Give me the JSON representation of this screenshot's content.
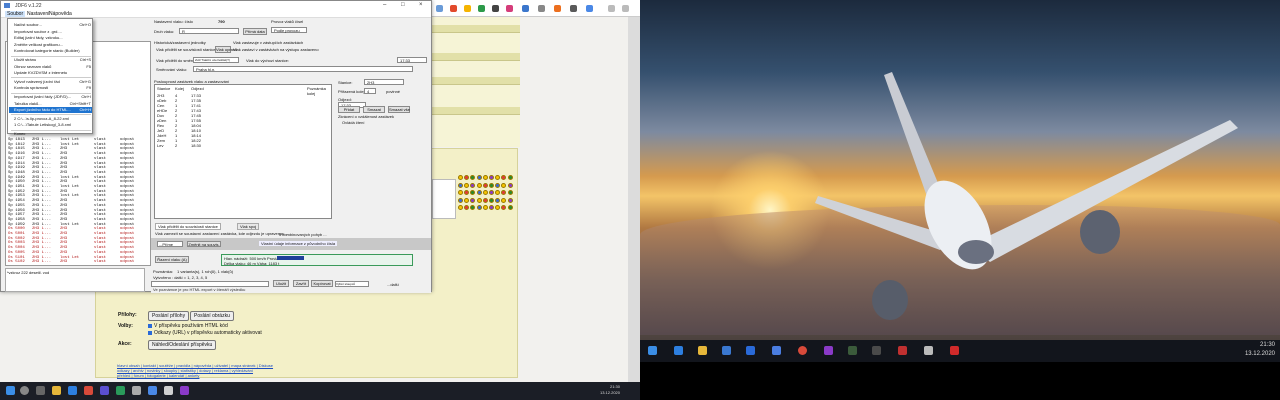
{
  "app": {
    "title": "JDF6 v.1.22",
    "menu": [
      "Soubor",
      "Nastavení",
      "Nápověda"
    ],
    "menu_colors": {
      "accent": "#1f74d0"
    }
  },
  "dropdown": {
    "items": [
      {
        "label": "Načíst soubor...",
        "key": "Ctrl+O"
      },
      {
        "label": "Importovat soubor z .grd....",
        "key": ""
      },
      {
        "label": "Editaj jízdní řády, vzkroku...",
        "key": ""
      },
      {
        "label": "Změňte velikost grafikonu...",
        "key": ""
      },
      {
        "label": "Kontrolovat kategorie stanic (Builder)",
        "key": ""
      },
      {
        "label": "Uložit stránu",
        "key": "Ctrl+S"
      },
      {
        "label": "Obnov seznam vlaků",
        "key": "F5"
      },
      {
        "label": "Update KVZDVSM z internetu",
        "key": ""
      },
      {
        "label": "Vytvoř nalezený jízdní řád",
        "key": "Ctrl+G"
      },
      {
        "label": "Kontrola správnosti",
        "key": "F9"
      },
      {
        "label": "Importovat jízdní řády (JDF/D)...",
        "key": "Ctrl+I"
      },
      {
        "label": "Tabulka vlaků...",
        "key": "Ctrl+Shift+T"
      },
      {
        "label": "Export jízdního řádu do HTML...",
        "key": "Ctrl+H"
      },
      {
        "label": "2 C:\\...\\s.lip-provoz-A_8-22.xml",
        "key": ""
      },
      {
        "label": "1 C:\\...\\Tabule Letiskogl_3-8.xml",
        "key": ""
      },
      {
        "label": "Konec",
        "key": ""
      }
    ]
  },
  "leftlist": {
    "rows": [
      {
        "a": "Sp 1813",
        "b": "2H3 L...",
        "c": "lost Let",
        "d": "vlast",
        "e": "odpost"
      },
      {
        "a": "Sp 1812",
        "b": "2H3 L...",
        "c": "lost Let",
        "d": "vlast",
        "e": "odpost"
      },
      {
        "a": "Sp 1815",
        "b": "2H3 L...",
        "c": "2H3",
        "d": "vlast",
        "e": "odpost"
      },
      {
        "a": "Sp 1916",
        "b": "2H3 L...",
        "c": "2H3",
        "d": "vlast",
        "e": "odpost"
      },
      {
        "a": "Sp 1917",
        "b": "2H3 L...",
        "c": "2H3",
        "d": "vlast",
        "e": "odpost"
      },
      {
        "a": "Sp 1914",
        "b": "2H3 L...",
        "c": "2H3",
        "d": "vlast",
        "e": "odpost"
      },
      {
        "a": "Sp 1919",
        "b": "2H3 L...",
        "c": "2H3",
        "d": "vlast",
        "e": "odpost"
      },
      {
        "a": "Sp 1948",
        "b": "2H3 L...",
        "c": "2H3",
        "d": "vlast",
        "e": "odpost"
      },
      {
        "a": "Sp 1949",
        "b": "2H3 L...",
        "c": "lost Let",
        "d": "vlast",
        "e": "odpost"
      },
      {
        "a": "Sp 1950",
        "b": "2H3 L...",
        "c": "2H3",
        "d": "vlast",
        "e": "odpost"
      },
      {
        "a": "Sp 1951",
        "b": "2H3 L...",
        "c": "lost Let",
        "d": "vlast",
        "e": "odpost"
      },
      {
        "a": "Sp 1952",
        "b": "2H3 L...",
        "c": "2H3",
        "d": "vlast",
        "e": "odpost"
      },
      {
        "a": "Sp 1953",
        "b": "2H3 L...",
        "c": "lost Let",
        "d": "vlast",
        "e": "odpost"
      },
      {
        "a": "Sp 1954",
        "b": "2H3 L...",
        "c": "2H3",
        "d": "vlast",
        "e": "odpost"
      },
      {
        "a": "Sp 1955",
        "b": "2H3 L...",
        "c": "2H3",
        "d": "vlast",
        "e": "odpost"
      },
      {
        "a": "Sp 1956",
        "b": "2H3 L...",
        "c": "2H3",
        "d": "vlast",
        "e": "odpost"
      },
      {
        "a": "Sp 1957",
        "b": "2H3 L...",
        "c": "2H3",
        "d": "vlast",
        "e": "odpost"
      },
      {
        "a": "Sp 1958",
        "b": "2H3 L...",
        "c": "2H3",
        "d": "vlast",
        "e": "odpost"
      },
      {
        "a": "Sp 1959",
        "b": "2H3 L...",
        "c": "lost Let",
        "d": "vlast",
        "e": "odpost"
      },
      {
        "a": "Os 5000",
        "b": "2H3 L...",
        "c": "2H3",
        "d": "vlast",
        "e": "odpost"
      },
      {
        "a": "Os 5001",
        "b": "2H3 L...",
        "c": "2H3",
        "d": "vlast",
        "e": "odpost"
      },
      {
        "a": "Os 5002",
        "b": "2H3 L...",
        "c": "2H3",
        "d": "vlast",
        "e": "odpost"
      },
      {
        "a": "Os 5003",
        "b": "2H3 L...",
        "c": "2H3",
        "d": "vlast",
        "e": "odpost"
      },
      {
        "a": "Os 5004",
        "b": "2H3 L...",
        "c": "2H3",
        "d": "vlast",
        "e": "odpost"
      },
      {
        "a": "Os 5005",
        "b": "2H3 L...",
        "c": "2H3",
        "d": "vlast",
        "e": "odpost"
      },
      {
        "a": "Os 5101",
        "b": "2H3 L...",
        "c": "lost Let",
        "d": "vlast",
        "e": "odpost"
      },
      {
        "a": "Os 5102",
        "b": "2H3 L...",
        "c": "2H3",
        "d": "vlast",
        "e": "odpost"
      }
    ],
    "note": "*vzkroz 222 desetil. vod"
  },
  "form": {
    "nastav_label": "Nastavení vlaku: číslo",
    "train_number": "790",
    "druh_label": "Druh vlaku:",
    "druh_value": "R",
    "prima_btn": "Přímá data",
    "vlastni_label": "Vlastní hodnoty",
    "povoz_label": "Provoz vlaků čísel",
    "povoz_value": "Podle provozu",
    "chk1": "Historická/zastavení jednotky",
    "chk2": "Vlak zastavuje v zástupčích zastávkách",
    "chk3": "Vlak zastaví v zastávkách na výstupu zastaveno",
    "pozn_label": "Vlak přidělit se souvislostí stanice:",
    "pozn_btn": "Vlak upravit",
    "razeni_label": "Vlak přidělit do směru:",
    "razeni_value": "2H3 Trakční uzel letiště(T)",
    "vlak_vychozi_label": "Vlak do výchozí stanice:",
    "vlak_vychozi_value": "17:33",
    "smer_label": "Směrování vlaku:",
    "smer_value": "Praha hl.n."
  },
  "table": {
    "caption": "Posloupnost zastávek vlaku a zastavování",
    "headers": [
      "Stanice",
      "Kolej",
      "Odjezd",
      "Poznámka kolej"
    ],
    "rows": [
      {
        "st": "2H3",
        "k": "4",
        "t": "17:33"
      },
      {
        "st": "xDeb",
        "k": "2",
        "t": "17:35"
      },
      {
        "st": "Cen",
        "k": "1",
        "t": "17:41"
      },
      {
        "st": "eHDe",
        "k": "2",
        "t": "17:43"
      },
      {
        "st": "Dov",
        "k": "2",
        "t": "17:45"
      },
      {
        "st": "zDen",
        "k": "1",
        "t": "17:55"
      },
      {
        "st": "Rec",
        "k": "2",
        "t": "18:04"
      },
      {
        "st": "JeD",
        "k": "2",
        "t": "18:10"
      },
      {
        "st": "JdeH",
        "k": "1",
        "t": "18:14"
      },
      {
        "st": "Zem",
        "k": "1",
        "t": "18:22"
      },
      {
        "st": "Lev",
        "k": "2",
        "t": "18:30"
      }
    ]
  },
  "right_panel": {
    "stanice_label": "Stanice:",
    "stanice_value": "2H3",
    "prirazeni_label": "Přiřazená kolej:",
    "prirazeni_value": "4",
    "povinne_label": "povinné",
    "odjezd_label": "Odjezd:",
    "odjezd_value": "17:33",
    "btn_pridat": "Přidat",
    "btn_smazat": "Smazat",
    "btn_smazat_vse": "Smazat vše",
    "poznamka": "Zkrácení o vzdálenost zastávek",
    "chk_ovlada": "Ovládá čtení"
  },
  "bottom": {
    "tab1": "Vlak přidělit do souvislostí stanice",
    "tab2": "Vlak spoj",
    "desc": "Vlak zamezit se soustavní zastavení zastávka, kde odjezdu je upravenou...",
    "chk_select": "5 kombinovaných pohyb ...",
    "selected_val": "...Příme",
    "zmenit_btn": "Změnit na souvis.",
    "gray_note": "Vlastní údaje informace z původního čísla",
    "razeni_btn": "Řazení vlaku (A)",
    "row1": "Hlav. nádraží: 500 km/h    Provizorní: 211 t",
    "row2": "Délka vlaku: 46 m      Váha: 1183 t",
    "vysledek_label": "Poznámka:",
    "vysledek_value": "1 varianta(s), 1 roh(ů), 1 vlak(ů)",
    "vysledek_list": "Vytvořeno :    další = 1, 2, 3, 4, 5",
    "odkaz": "Ve poznámce je pro HTML export v čtenáři výsledku",
    "btn_ulozit": "Uložit",
    "btn_zavrit": "Zavřít",
    "btn_kopie": "Kopírovat",
    "btn_vyber": "Výběr sloupců",
    "btn_dalsi": "...další"
  },
  "forum": {
    "prilohy_label": "Přílohy:",
    "btn_poslani": "Poslání přílohy",
    "btn_poslani2": "Poslání obrázku",
    "volby_label": "Volby:",
    "opt1": "V příspěvku používám HTML kód",
    "opt2": "Odkazy (URL) v příspěvku automaticky aktivovat",
    "akce_label": "Akce:",
    "btn_nahled": "Náhled/Odeslání příspěvku",
    "footer_line1": "hlavní obsah | kontakt | soutěže | pravidla | nápověda | uživatel | mapa stránek | Diskuse",
    "footer_line2": "odkazy | archiv | novinky | sloupky | statistiky | dotazy | reklama | vyhledávání",
    "footer_line3": "přehled | fórum | fotogalerie | kalendář | ankety"
  },
  "taskbar_left": {
    "time": "21:30",
    "date": "13.12.2020"
  },
  "taskbar_right": {
    "time": "21:30",
    "date": "13.12.2020"
  }
}
